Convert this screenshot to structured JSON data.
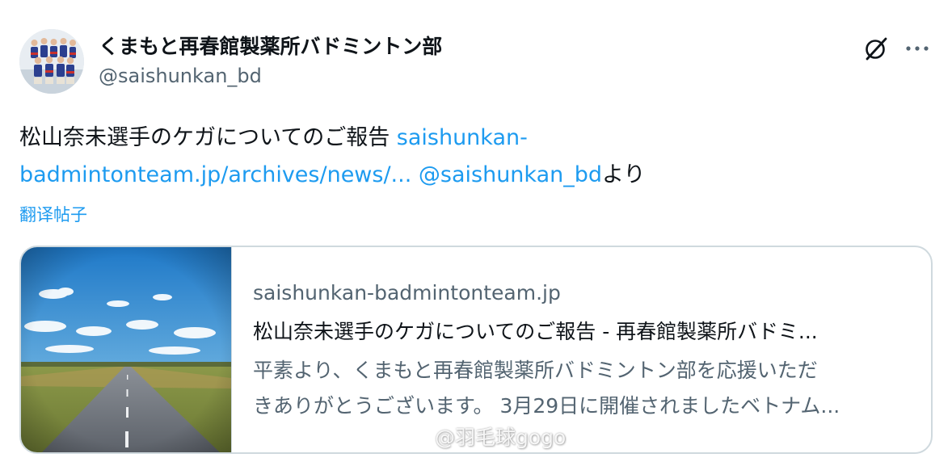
{
  "author": {
    "name": "くまもと再春館製薬所バドミントン部",
    "handle": "@saishunkan_bd"
  },
  "actions": {
    "grok_icon": "grok-icon",
    "more_icon": "more-dots-icon"
  },
  "post": {
    "text_lead": "松山奈未選手のケガについてのご報告 ",
    "link_url_1": "saishunkan-",
    "link_url_2": "badmintonteam.jp/archives/news/...",
    "text_space": " ",
    "mention": "@saishunkan_bd",
    "text_tail": "より",
    "translate_label": "翻译帖子"
  },
  "card": {
    "domain": "saishunkan-badmintonteam.jp",
    "title": "松山奈未選手のケガについてのご報告 - 再春館製薬所バドミ...",
    "description_line1": "平素より、くまもと再春館製薬所バドミントン部を応援いただ",
    "description_line2": "きありがとうございます。 3月29日に開催されましたベトナム..."
  },
  "watermark": {
    "text": "@羽毛球gogo",
    "icon": "weibo-icon"
  },
  "colors": {
    "link": "#1d9bf0",
    "text": "#0f1419",
    "secondary": "#536471",
    "border": "#cfd9de"
  }
}
